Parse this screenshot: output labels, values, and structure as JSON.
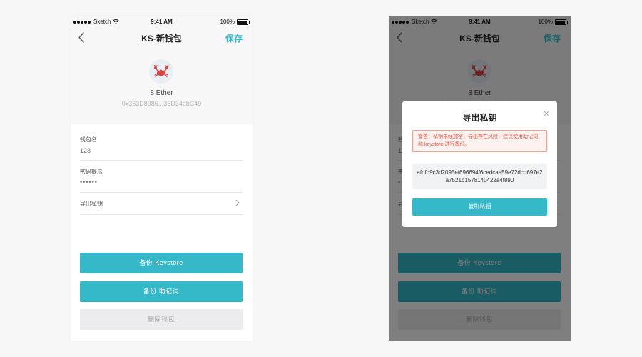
{
  "status_bar": {
    "carrier": "Sketch",
    "time": "9:41 AM",
    "battery": "100%"
  },
  "navbar": {
    "title": "KS-新钱包",
    "save_label": "保存"
  },
  "wallet": {
    "balance": "8 Ether",
    "address": "0x363D8986...35D34dbC49",
    "avatar_icon": "crab-icon"
  },
  "fields": {
    "name_label": "钱包名",
    "name_value": "123",
    "hint_label": "密码提示",
    "hint_value": "••••••",
    "export_label": "导出私钥"
  },
  "buttons": {
    "backup_keystore": "备份 Keystore",
    "backup_mnemonic": "备份 助记词",
    "delete_wallet": "删除钱包"
  },
  "modal": {
    "title": "导出私钥",
    "warning": "警告：私钥未经加密，导出存在风险，建议使用助记词和 keystore 进行备份。",
    "private_key": "afdfd9c3d2095ef696694f6cedcae59e72dcd697e2a7521b1578140422a4f890",
    "copy_label": "复制私钥"
  },
  "colors": {
    "accent": "#35b8c8",
    "background": "#f7f7f8",
    "danger_text": "#e0533d",
    "disabled_button": "#ececee"
  }
}
